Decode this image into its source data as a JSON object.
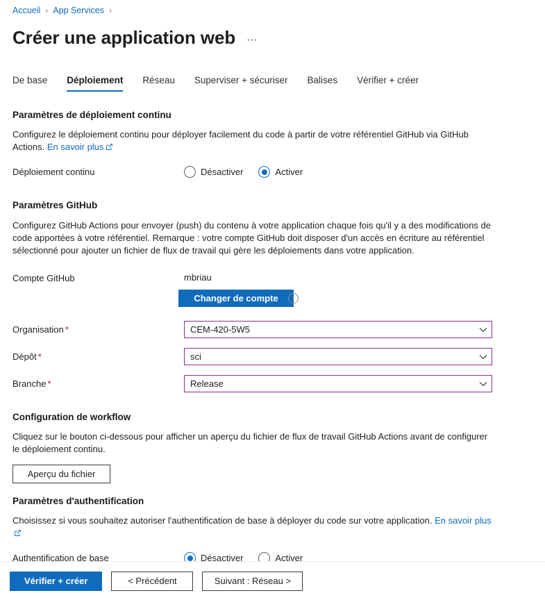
{
  "breadcrumb": {
    "items": [
      {
        "label": "Accueil"
      },
      {
        "label": "App Services"
      }
    ],
    "separator": "›"
  },
  "header": {
    "title": "Créer une application web",
    "ellipsis": "⋯"
  },
  "tabs": [
    {
      "label": "De base",
      "active": false
    },
    {
      "label": "Déploiement",
      "active": true
    },
    {
      "label": "Réseau",
      "active": false
    },
    {
      "label": "Superviser + sécuriser",
      "active": false
    },
    {
      "label": "Balises",
      "active": false
    },
    {
      "label": "Vérifier + créer",
      "active": false
    }
  ],
  "continuous_deployment": {
    "heading": "Paramètres de déploiement continu",
    "description_part1": "Configurez le déploiement continu pour déployer facilement du code à partir de votre référentiel GitHub via GitHub Actions.",
    "learn_more": "En savoir plus",
    "row_label": "Déploiement continu",
    "options": [
      {
        "label": "Désactiver",
        "selected": false
      },
      {
        "label": "Activer",
        "selected": true
      }
    ]
  },
  "github_settings": {
    "heading": "Paramètres GitHub",
    "description": "Configurez GitHub Actions pour envoyer (push) du contenu à votre application chaque fois qu'il y a des modifications de code apportées à votre référentiel. Remarque : votre compte GitHub doit disposer d'un accès en écriture au référentiel sélectionné pour ajouter un fichier de flux de travail qui gère les déploiements dans votre application.",
    "account_label": "Compte GitHub",
    "account_value": "mbriau",
    "change_account_button": "Changer de compte",
    "info_glyph": "i",
    "fields": [
      {
        "label": "Organisation",
        "required": true,
        "required_mark": "*",
        "value": "CEM-420-5W5"
      },
      {
        "label": "Dépôt",
        "required": true,
        "required_mark": "*",
        "value": "sci"
      },
      {
        "label": "Branche",
        "required": true,
        "required_mark": "*",
        "value": "Release"
      }
    ]
  },
  "workflow": {
    "heading": "Configuration de workflow",
    "description": "Cliquez sur le bouton ci-dessous pour afficher un aperçu du fichier de flux de travail GitHub Actions avant de configurer le déploiement continu.",
    "preview_button": "Aperçu du fichier"
  },
  "authentication": {
    "heading": "Paramètres d'authentification",
    "description_part1": "Choisissez si vous souhaitez autoriser l'authentification de base à déployer du code sur votre application.",
    "learn_more": "En savoir plus",
    "row_label": "Authentification de base",
    "options": [
      {
        "label": "Désactiver",
        "selected": true
      },
      {
        "label": "Activer",
        "selected": false
      }
    ]
  },
  "footer": {
    "review_create": "Vérifier + créer",
    "previous": "< Précédent",
    "next": "Suivant : Réseau  >"
  },
  "colors": {
    "accent_blue": "#0f6cbd",
    "field_border_purple": "#8e2d8e",
    "required_red": "#a4262c"
  }
}
